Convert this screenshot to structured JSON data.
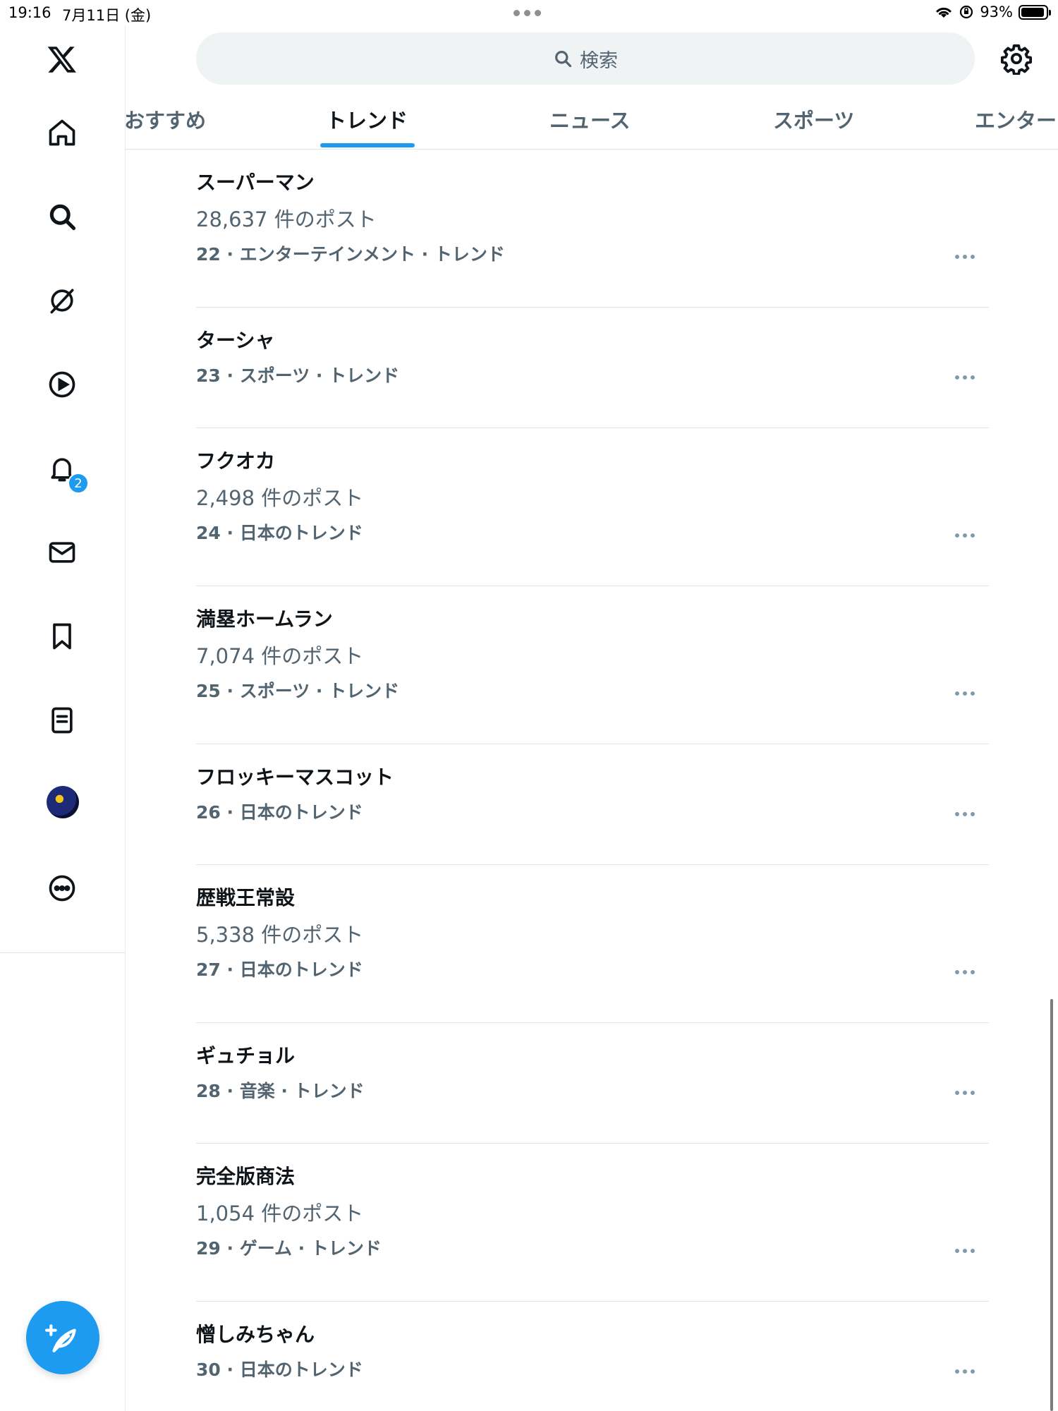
{
  "status_bar": {
    "time": "19:16",
    "date": "7月11日 (金)",
    "battery": "93%",
    "battery_level": 0.93
  },
  "sidebar": {
    "logo": "x-logo-icon",
    "items": [
      {
        "name": "home",
        "icon": "home-icon"
      },
      {
        "name": "search",
        "icon": "search-icon"
      },
      {
        "name": "grok",
        "icon": "grok-icon"
      },
      {
        "name": "videos",
        "icon": "play-icon"
      },
      {
        "name": "notifications",
        "icon": "bell-icon",
        "badge": "2"
      },
      {
        "name": "messages",
        "icon": "mail-icon"
      },
      {
        "name": "bookmarks",
        "icon": "bookmark-icon"
      },
      {
        "name": "lists",
        "icon": "list-icon"
      },
      {
        "name": "profile",
        "icon": "avatar"
      },
      {
        "name": "more",
        "icon": "more-circle-icon"
      }
    ],
    "compose_icon": "compose-feather-icon"
  },
  "search": {
    "placeholder": "検索"
  },
  "tabs": [
    {
      "label": "おすすめ",
      "active": false
    },
    {
      "label": "トレンド",
      "active": true
    },
    {
      "label": "ニュース",
      "active": false
    },
    {
      "label": "スポーツ",
      "active": false
    },
    {
      "label": "エンター",
      "active": false
    }
  ],
  "trends": [
    {
      "name": "スーパーマン",
      "posts": "28,637 件のポスト",
      "meta": "22 · エンターテインメント · トレンド"
    },
    {
      "name": "ターシャ",
      "posts": "",
      "meta": "23 · スポーツ · トレンド"
    },
    {
      "name": "フクオカ",
      "posts": "2,498 件のポスト",
      "meta": "24 · 日本のトレンド"
    },
    {
      "name": "満塁ホームラン",
      "posts": "7,074 件のポスト",
      "meta": "25 · スポーツ · トレンド"
    },
    {
      "name": "フロッキーマスコット",
      "posts": "",
      "meta": "26 · 日本のトレンド"
    },
    {
      "name": "歴戦王常設",
      "posts": "5,338 件のポスト",
      "meta": "27 · 日本のトレンド"
    },
    {
      "name": "ギュチョル",
      "posts": "",
      "meta": "28 · 音楽 · トレンド"
    },
    {
      "name": "完全版商法",
      "posts": "1,054 件のポスト",
      "meta": "29 · ゲーム · トレンド"
    },
    {
      "name": "憎しみちゃん",
      "posts": "",
      "meta": "30 · 日本のトレンド"
    }
  ],
  "colors": {
    "accent": "#1d9bf0",
    "text_primary": "#0f1419",
    "text_secondary": "#536471",
    "divider": "#e1e5e8",
    "search_bg": "#eff3f4"
  }
}
